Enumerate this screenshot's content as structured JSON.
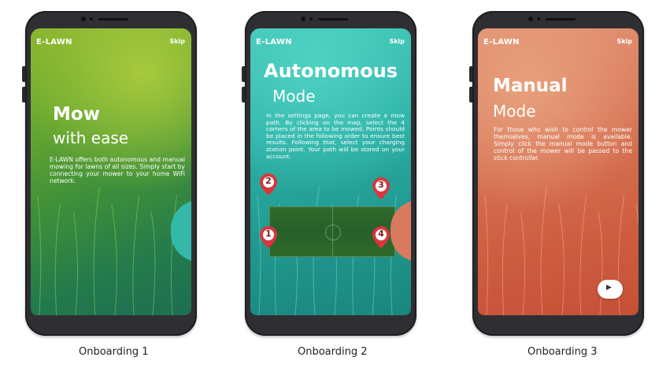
{
  "screens": [
    {
      "brand": "E-LAWN",
      "skip": "Skip",
      "title": "Mow",
      "subtitle": "with ease",
      "body": "E-LAWN offers both autonomous and manual mowing for lawns of all sizes. Simply start by connecting your mower to your home WiFi network.",
      "next_icon": "chevron-right-icon",
      "caption": "Onboarding 1"
    },
    {
      "brand": "E-LAWN",
      "skip": "Skip",
      "title": "Autonomous",
      "subtitle": "Mode",
      "body": "In the settings page, you can create a mow path. By clicking on the map, select the 4 corners of the area to be mowed. Points should be placed in the following order to ensure best results. Following that, select your charging station point. Your path will be stored on your account.",
      "pins": [
        "1",
        "2",
        "3",
        "4"
      ],
      "caption": "Onboarding 2"
    },
    {
      "brand": "E-LAWN",
      "skip": "Skip",
      "title": "Manual",
      "subtitle": "Mode",
      "body": "For those who wish to control the mower themselves, manual mode is available. Simply click the manual mode button and control of the mower will be passed to the stick controller.",
      "next_icon": "play-icon",
      "caption": "Onboarding 3"
    }
  ],
  "colors": {
    "green_theme": "#6caa2f",
    "teal_theme": "#2bb0a6",
    "coral_theme": "#d77658",
    "pin_red": "#d9363e",
    "phone_body": "#2f2f33"
  }
}
